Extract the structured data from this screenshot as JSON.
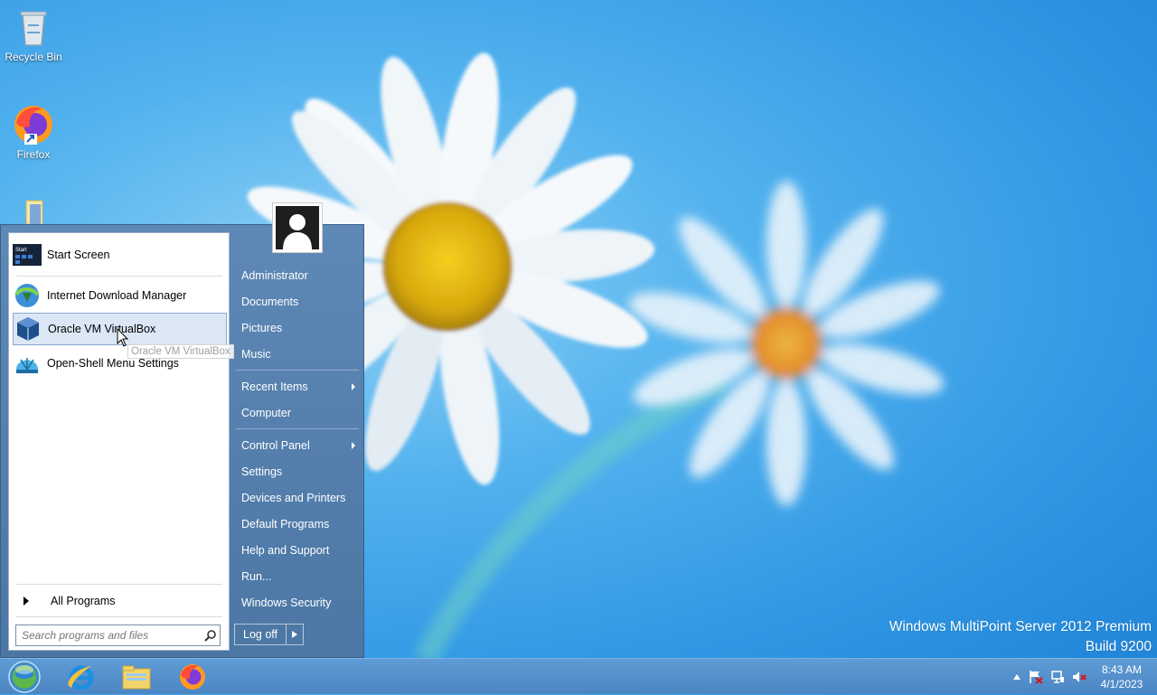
{
  "desktop": {
    "icons": [
      {
        "label": "Recycle Bin",
        "icon": "recycle-bin-icon"
      },
      {
        "label": "Firefox",
        "icon": "firefox-icon"
      },
      {
        "label": "",
        "icon": "folder-icon"
      }
    ]
  },
  "start_menu": {
    "programs": [
      {
        "label": "Start Screen",
        "icon": "start-screen-icon"
      },
      {
        "label": "Internet Download Manager",
        "icon": "idm-icon"
      },
      {
        "label": "Oracle VM VirtualBox",
        "icon": "virtualbox-icon",
        "highlighted": true
      },
      {
        "label": "Open-Shell Menu Settings",
        "icon": "open-shell-icon"
      }
    ],
    "tooltip": "Oracle VM VirtualBox",
    "all_programs": "All Programs",
    "search_placeholder": "Search programs and files",
    "right_items": [
      {
        "label": "Administrator"
      },
      {
        "label": "Documents"
      },
      {
        "label": "Pictures"
      },
      {
        "label": "Music"
      },
      {
        "label": "Recent Items",
        "submenu": true
      },
      {
        "label": "Computer"
      },
      {
        "label": "Control Panel",
        "submenu": true
      },
      {
        "label": "Settings"
      },
      {
        "label": "Devices and Printers"
      },
      {
        "label": "Default Programs"
      },
      {
        "label": "Help and Support"
      },
      {
        "label": "Run..."
      },
      {
        "label": "Windows Security"
      }
    ],
    "logoff": "Log off"
  },
  "watermark": {
    "line1": "Windows MultiPoint Server 2012 Premium",
    "line2": "Build 9200"
  },
  "taskbar": {
    "buttons": [
      "start-orb-icon",
      "internet-explorer-icon",
      "file-explorer-icon",
      "firefox-icon"
    ],
    "clock": {
      "time": "8:43 AM",
      "date": "4/1/2023"
    }
  },
  "colors": {
    "menu_blue": "#4c77a5",
    "taskbar": "#4b86c4",
    "desktop": "#2f97e4"
  }
}
